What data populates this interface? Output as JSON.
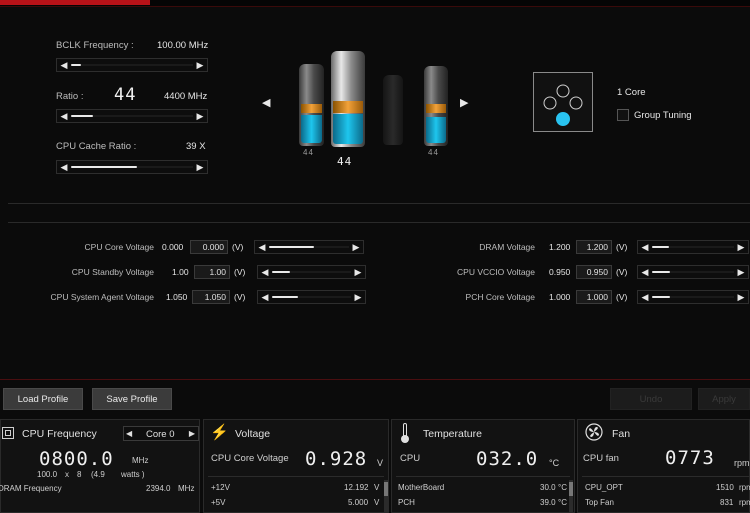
{
  "freq": {
    "bclk_label": "BCLK Frequency :",
    "bclk_value": "100.00 MHz",
    "ratio_label": "Ratio :",
    "ratio_value": "44",
    "ratio_mhz": "4400 MHz",
    "cache_label": "CPU Cache Ratio :",
    "cache_value": "39 X"
  },
  "tubes": {
    "labels": [
      "44",
      "44",
      "",
      "44"
    ],
    "center_value": "44"
  },
  "core": {
    "label": "1 Core",
    "group_tuning": "Group Tuning",
    "group_tuning_checked": false
  },
  "voltages_left": [
    {
      "label": "CPU Core Voltage",
      "value": "0.000",
      "input": "0.000",
      "unit": "(V)",
      "level": 0.55
    },
    {
      "label": "CPU Standby Voltage",
      "value": "1.00",
      "input": "1.00",
      "unit": "(V)",
      "level": 0.22
    },
    {
      "label": "CPU System Agent Voltage",
      "value": "1.050",
      "input": "1.050",
      "unit": "(V)",
      "level": 0.32
    }
  ],
  "voltages_right": [
    {
      "label": "DRAM Voltage",
      "value": "1.200",
      "input": "1.200",
      "unit": "(V)",
      "level": 0.2
    },
    {
      "label": "CPU VCCIO Voltage",
      "value": "0.950",
      "input": "0.950",
      "unit": "(V)",
      "level": 0.22
    },
    {
      "label": "PCH Core Voltage",
      "value": "1.000",
      "input": "1.000",
      "unit": "(V)",
      "level": 0.22
    }
  ],
  "buttons": {
    "load": "Load Profile",
    "save": "Save Profile",
    "undo": "Undo",
    "apply": "Apply"
  },
  "cpu_freq_panel": {
    "title": "CPU Frequency",
    "core_select": "Core 0",
    "big": "0800.0",
    "unit": "MHz",
    "sub1": "100.0",
    "sub_x": "x",
    "sub2": "8",
    "sub3": "(4.9",
    "sub4": "watts )",
    "dram_label": "DRAM Frequency",
    "dram_value": "2394.0",
    "dram_unit": "MHz"
  },
  "voltage_panel": {
    "title": "Voltage",
    "main_label": "CPU Core Voltage",
    "main_value": "0.928",
    "main_unit": "V",
    "rows": [
      {
        "label": "+12V",
        "value": "12.192",
        "unit": "V"
      },
      {
        "label": "+5V",
        "value": "5.000",
        "unit": "V"
      }
    ]
  },
  "temp_panel": {
    "title": "Temperature",
    "main_label": "CPU",
    "main_value": "032.0",
    "main_unit": "°C",
    "rows": [
      {
        "label": "MotherBoard",
        "value": "30.0",
        "unit": "°C"
      },
      {
        "label": "PCH",
        "value": "39.0",
        "unit": "°C"
      }
    ]
  },
  "fan_panel": {
    "title": "Fan",
    "main_label": "CPU fan",
    "main_value": "0773",
    "main_unit": "rpm",
    "rows": [
      {
        "label": "CPU_OPT",
        "value": "1510",
        "unit": "rpm"
      },
      {
        "label": "Top Fan",
        "value": "831",
        "unit": "rpm"
      }
    ]
  },
  "colors": {
    "accent_red": "#b81218",
    "accent_blue": "#1ec6ee",
    "accent_orange": "#f2a23a"
  }
}
